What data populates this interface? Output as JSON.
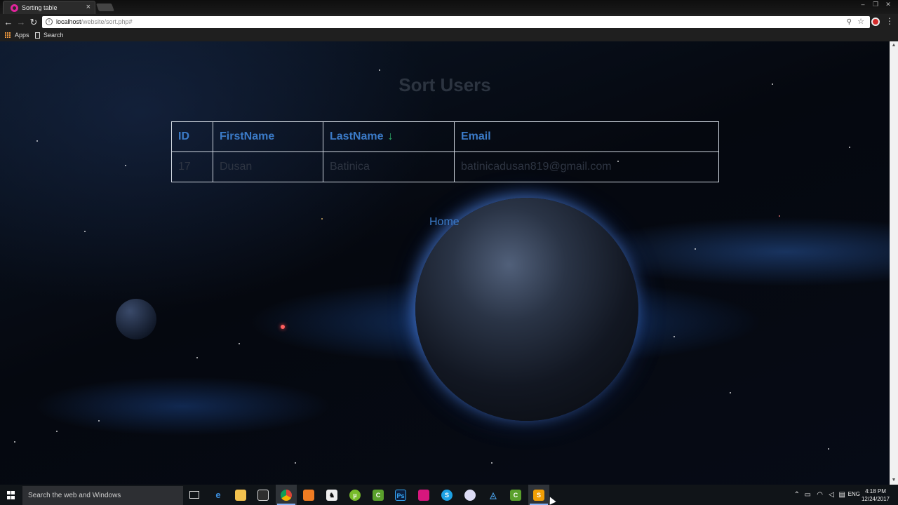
{
  "browser": {
    "tab_title": "Sorting table",
    "tab_close": "×",
    "url_host": "localhost",
    "url_path": "/website/sort.php#",
    "bookmarks": {
      "apps": "Apps",
      "search": "Search"
    },
    "icons": [
      "back-icon",
      "forward-icon",
      "reload-icon",
      "info-icon",
      "zoom-icon",
      "star-icon",
      "opera-extension-icon",
      "menu-icon"
    ]
  },
  "page": {
    "title": "Sort Users",
    "table": {
      "headers": {
        "id": "ID",
        "first": "FirstName",
        "last": "LastName",
        "email": "Email"
      },
      "sort_indicator": "↓",
      "sorted_column": "LastName",
      "rows": [
        {
          "id": "17",
          "first": "Dusan",
          "last": "Batinica",
          "email": "batinicadusan819@gmail.com"
        }
      ]
    },
    "home_link": "Home",
    "colors": {
      "link": "#3b7bc8",
      "sort_arrow": "#2fb46c",
      "muted_text": "#2e3542"
    }
  },
  "taskbar": {
    "search_placeholder": "Search the web and Windows",
    "language": "ENG",
    "time": "4:18 PM",
    "date": "12/24/2017",
    "pinned_icons": [
      "task-view-icon",
      "edge-icon",
      "file-explorer-icon",
      "store-icon",
      "chrome-icon",
      "brave-icon",
      "inkscape-icon",
      "utorrent-icon",
      "camtasia-icon",
      "photoshop-icon",
      "pink-app-icon",
      "skype-icon",
      "media-player-icon",
      "azure-icon",
      "camtasia-recorder-icon",
      "sublime-text-icon"
    ]
  }
}
